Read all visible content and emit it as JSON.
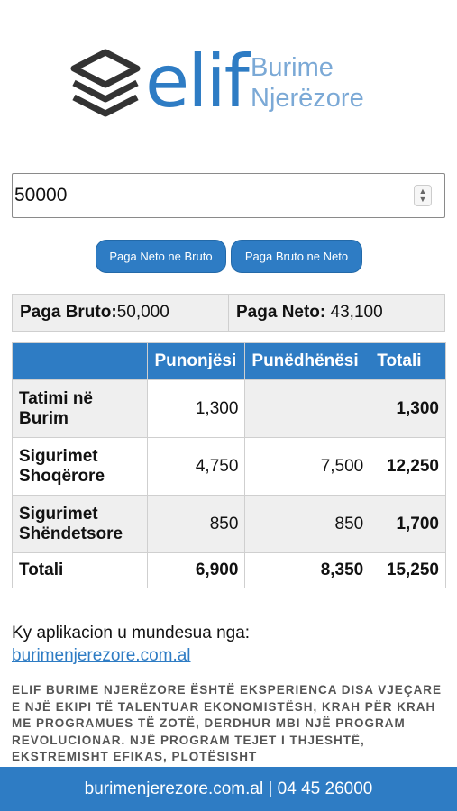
{
  "logo": {
    "word": "elif",
    "line1": "Burime",
    "line2": "Njerëzore"
  },
  "input": {
    "value": "50000"
  },
  "buttons": {
    "net_to_gross": "Paga Neto ne Bruto",
    "gross_to_net": "Paga Bruto ne Neto"
  },
  "summary": {
    "gross_label": "Paga Bruto:",
    "gross_value": "50,000",
    "net_label": "Paga Neto:",
    "net_value": " 43,100"
  },
  "table": {
    "headers": [
      "",
      "Punonjësi",
      "Punëdhënësi",
      "Totali"
    ],
    "rows": [
      {
        "label": "Tatimi në Burim",
        "employee": "1,300",
        "employer": "",
        "total": "1,300"
      },
      {
        "label": "Sigurimet Shoqërore",
        "employee": "4,750",
        "employer": "7,500",
        "total": "12,250"
      },
      {
        "label": "Sigurimet Shëndetsore",
        "employee": "850",
        "employer": "850",
        "total": "1,700"
      },
      {
        "label": "Totali",
        "employee": "6,900",
        "employer": "8,350",
        "total": "15,250"
      }
    ]
  },
  "credit": {
    "text": "Ky aplikacion u mundesua nga:",
    "link": "burimenjerezore.com.al"
  },
  "description": "Elif Burime Njerëzore është eksperienca disa vjeçare e një ekipi të talentuar ekonomistësh, krah për krah me programues të zotë, derdhur mbi një program revolucionar. Një program tejet i thjeshtë, ekstremisht efikas, plotësisht",
  "footer": "burimenjerezore.com.al | 04 45 26000",
  "colors": {
    "accent": "#2e7cc4",
    "logo_light": "#7ba9d6",
    "row_grey": "#efefef"
  }
}
